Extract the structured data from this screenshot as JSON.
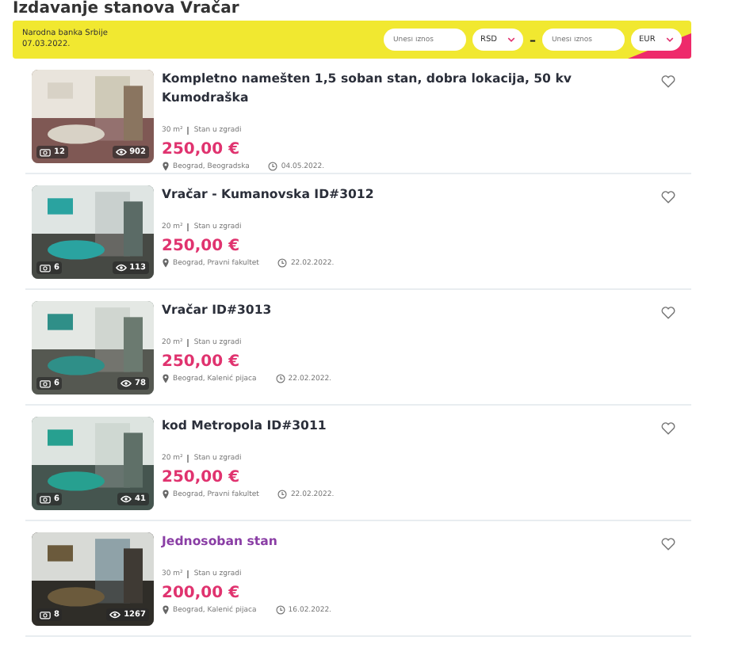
{
  "page_title": "Izdavanje stanova Vračar",
  "rate_bar": {
    "source": "Narodna banka Srbije",
    "date": "07.03.2022.",
    "min_placeholder": "Unesi iznos",
    "min_currency": "RSD",
    "separator": "–",
    "max_placeholder": "Unesi iznos",
    "max_currency": "EUR"
  },
  "listings": [
    {
      "title": "Kompletno namešten 1,5 soban stan, dobra lokacija, 50 kv Kumodraška",
      "visited": false,
      "photos": "12",
      "views": "902",
      "area": "30 m²",
      "type": "Stan u zgradi",
      "price": "250,00 €",
      "location": "Beograd, Beogradska",
      "date": "04.05.2022."
    },
    {
      "title": "Vračar - Kumanovska ID#3012",
      "visited": false,
      "photos": "6",
      "views": "113",
      "area": "20 m²",
      "type": "Stan u zgradi",
      "price": "250,00 €",
      "location": "Beograd, Pravni fakultet",
      "date": "22.02.2022."
    },
    {
      "title": "Vračar ID#3013",
      "visited": false,
      "photos": "6",
      "views": "78",
      "area": "20 m²",
      "type": "Stan u zgradi",
      "price": "250,00 €",
      "location": "Beograd, Kalenić pijaca",
      "date": "22.02.2022."
    },
    {
      "title": "kod Metropola ID#3011",
      "visited": false,
      "photos": "6",
      "views": "41",
      "area": "20 m²",
      "type": "Stan u zgradi",
      "price": "250,00 €",
      "location": "Beograd, Pravni fakultet",
      "date": "22.02.2022."
    },
    {
      "title": "Jednosoban stan",
      "visited": true,
      "photos": "8",
      "views": "1267",
      "area": "30 m²",
      "type": "Stan u zgradi",
      "price": "200,00 €",
      "location": "Beograd, Kalenić pijaca",
      "date": "16.02.2022."
    }
  ]
}
